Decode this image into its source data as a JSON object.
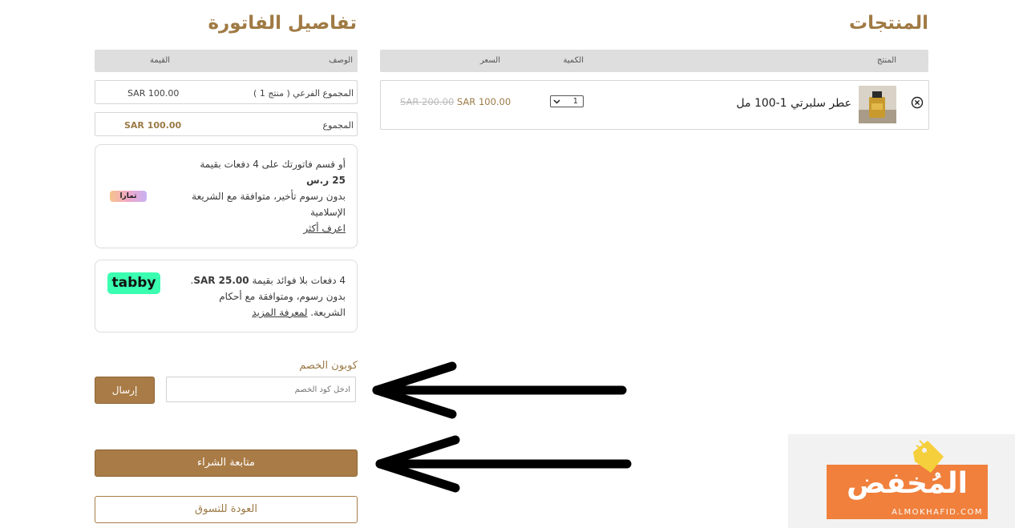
{
  "products": {
    "title": "المنتجات",
    "columns": {
      "product": "المنتج",
      "quantity": "الكمية",
      "price": "السعر"
    },
    "items": [
      {
        "name": "عطر سلبرتي 1-100 مل",
        "quantity": "1",
        "price": "SAR 100.00",
        "old_price": "SAR 200.00"
      }
    ]
  },
  "invoice": {
    "title": "تفاصيل الفاتورة",
    "columns": {
      "description": "الوصف",
      "value": "القيمة"
    },
    "rows": [
      {
        "label": "المجموع الفرعي ( منتج 1 )",
        "value": "SAR 100.00"
      },
      {
        "label": "المجموع",
        "value": "SAR 100.00"
      }
    ]
  },
  "tamara": {
    "line1": "أو قسم فاتورتك على 4 دفعات بقيمة",
    "line2": "25 ر.س",
    "line3": "بدون رسوم تأخير، متوافقة مع الشريعة",
    "line4": "الإسلامية",
    "link": "اعرف أكثر",
    "logo": "تمارا"
  },
  "tabby": {
    "line1_prefix": "4 دفعات بلا فوائد بقيمة ",
    "amount": "SAR 25.00",
    "line1_suffix": ".",
    "line2": "بدون رسوم، ومتوافقة مع أحكام",
    "line3_prefix": "الشريعة. ",
    "link": "لمعرفة المزيد",
    "logo": "tabby"
  },
  "coupon": {
    "label": "كوبون الخصم",
    "placeholder": "ادخل كود الخصم",
    "submit": "إرسال"
  },
  "actions": {
    "checkout": "متابعة الشراء",
    "back": "العودة للتسوق"
  },
  "watermark": {
    "brand": "المُخفض",
    "site": "ALMOKHAFID.COM"
  },
  "colors": {
    "accent": "#a97b46",
    "tabby_green": "#3bffb0",
    "brand_orange": "#f0803c"
  }
}
